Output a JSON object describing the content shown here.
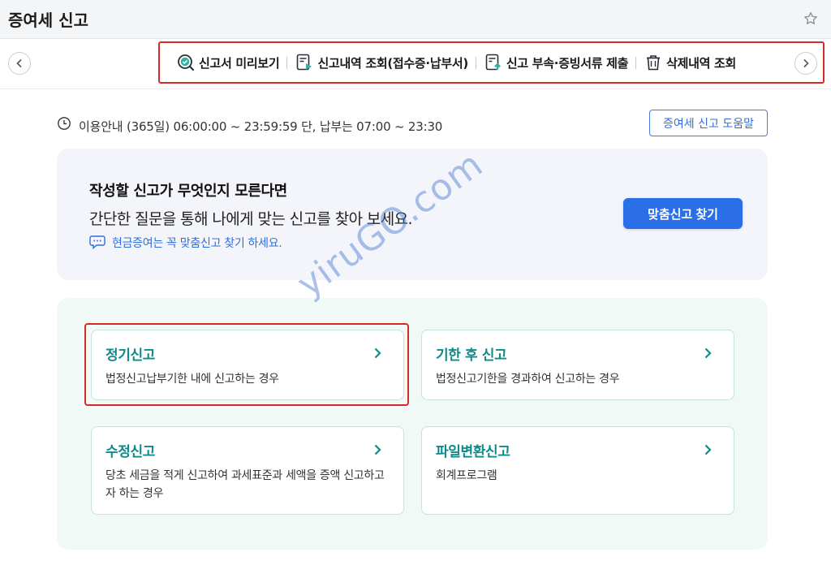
{
  "header": {
    "title": "증여세 신고"
  },
  "toolbar": {
    "items": [
      {
        "label": "신고서 미리보기",
        "icon": "search-check-icon"
      },
      {
        "label": "신고내역 조회(접수증·납부서)",
        "icon": "document-play-icon"
      },
      {
        "label": "신고 부속·증빙서류 제출",
        "icon": "document-upload-icon"
      },
      {
        "label": "삭제내역 조회",
        "icon": "trash-icon"
      }
    ]
  },
  "info": {
    "text": "이용안내 (365일) 06:00:00 ~ 23:59:59 단, 납부는 07:00 ~ 23:30",
    "help_button": "증여세 신고 도움말"
  },
  "finder": {
    "title": "작성할 신고가 무엇인지 모른다면",
    "subtitle": "간단한 질문을 통해 나에게 맞는 신고를 찾아 보세요.",
    "tip": "현금증여는 꼭 맞춤신고 찾기 하세요.",
    "button": "맞춤신고 찾기"
  },
  "cards": [
    {
      "title": "정기신고",
      "desc": "법정신고납부기한 내에 신고하는 경우"
    },
    {
      "title": "기한 후 신고",
      "desc": "법정신고기한을 경과하여 신고하는 경우"
    },
    {
      "title": "수정신고",
      "desc": "당초 세금을 적게 신고하여 과세표준과 세액을 증액 신고하고자 하는 경우"
    },
    {
      "title": "파일변환신고",
      "desc": "회계프로그램"
    }
  ],
  "watermark": "yiruGO.com",
  "colors": {
    "accent": "#2a6ee8",
    "card_title": "#0e8a8a",
    "highlight": "#d62a2a"
  }
}
